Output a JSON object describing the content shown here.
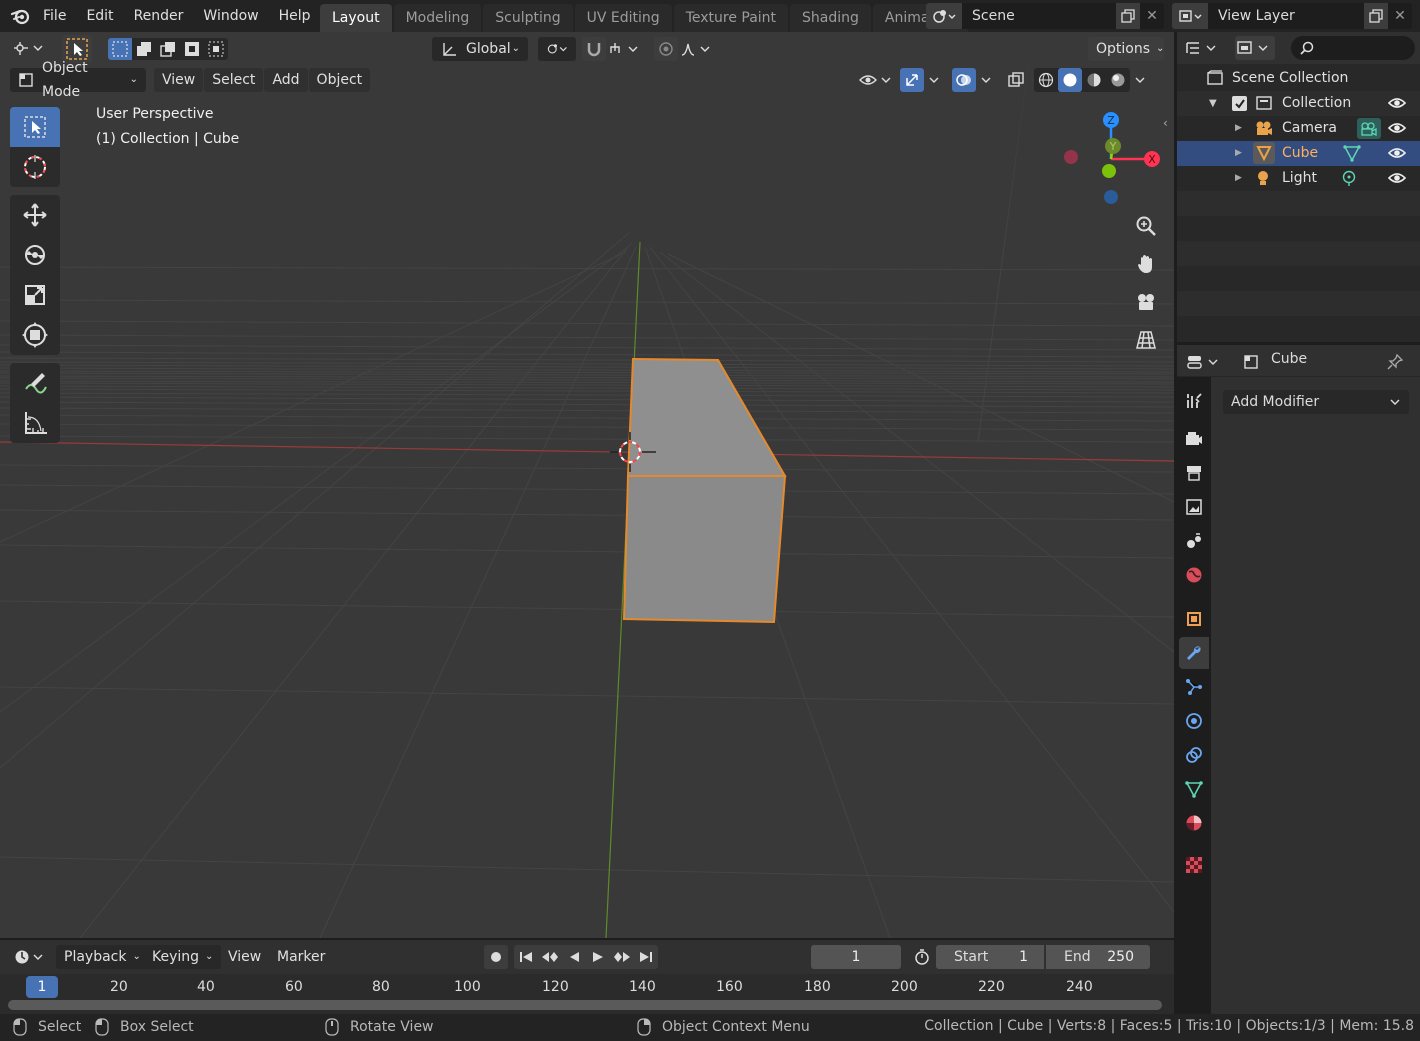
{
  "menubar": {
    "items": [
      "File",
      "Edit",
      "Render",
      "Window",
      "Help"
    ],
    "workspaces": [
      "Layout",
      "Modeling",
      "Sculpting",
      "UV Editing",
      "Texture Paint",
      "Shading",
      "Animation"
    ],
    "active_workspace": "Layout",
    "scene": "Scene",
    "view_layer": "View Layer"
  },
  "viewport": {
    "transform_orientation": "Global",
    "options_label": "Options",
    "mode": "Object Mode",
    "menus": [
      "View",
      "Select",
      "Add",
      "Object"
    ],
    "overlay_line1": "User Perspective",
    "overlay_line2": "(1) Collection | Cube",
    "gizmo": {
      "x": "X",
      "y": "Y",
      "z": "Z"
    }
  },
  "timeline": {
    "menus": [
      "Playback",
      "Keying",
      "View",
      "Marker"
    ],
    "current_frame": "1",
    "start_label": "Start",
    "start": "1",
    "end_label": "End",
    "end": "250",
    "ticks": [
      "1",
      "20",
      "40",
      "60",
      "80",
      "100",
      "120",
      "140",
      "160",
      "180",
      "200",
      "220",
      "240"
    ]
  },
  "statusbar": {
    "select": "Select",
    "box_select": "Box Select",
    "rotate_view": "Rotate View",
    "context_menu": "Object Context Menu",
    "stats": "Collection | Cube | Verts:8 | Faces:5 | Tris:10 | Objects:1/3 | Mem: 15.8"
  },
  "outliner": {
    "root": "Scene Collection",
    "collection": "Collection",
    "items": [
      {
        "name": "Camera",
        "icon": "camera-icon",
        "color": "#e8a34c"
      },
      {
        "name": "Cube",
        "icon": "mesh-icon",
        "color": "#e8a34c"
      },
      {
        "name": "Light",
        "icon": "light-icon",
        "color": "#e8a34c"
      }
    ],
    "selected": "Cube"
  },
  "properties": {
    "object_name": "Cube",
    "add_modifier": "Add Modifier"
  },
  "colors": {
    "accent": "#4772b3",
    "selection": "#ff9c2a",
    "x_axis": "#ff3352",
    "y_axis": "#8bdc00",
    "z_axis": "#2890ff"
  }
}
